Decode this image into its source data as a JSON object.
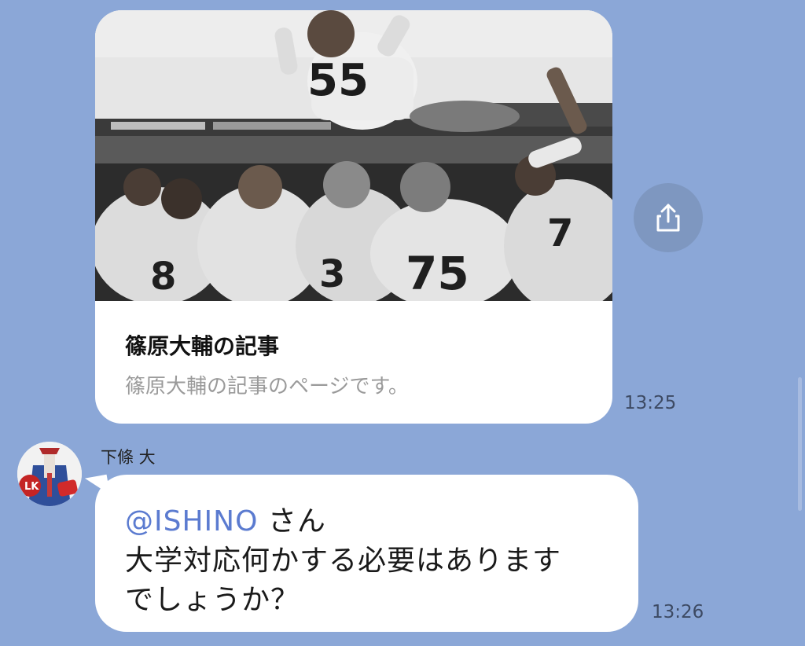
{
  "link_card": {
    "title": "篠原大輔の記事",
    "description": "篠原大輔の記事のページです。",
    "image": "football-team-celebration-photo",
    "time": "13:25"
  },
  "share_icon": "share-icon",
  "message": {
    "sender_name": "下條 大",
    "mention": "@ISHINO",
    "line1_suffix": " さん",
    "line2": "大学対応何かする必要はあります",
    "line3": "でしょうか？",
    "time": "13:26"
  },
  "colors": {
    "background": "#8ba7d7",
    "bubble": "#ffffff",
    "mention": "#5b7bd0",
    "share_button": "#7e97c0"
  }
}
